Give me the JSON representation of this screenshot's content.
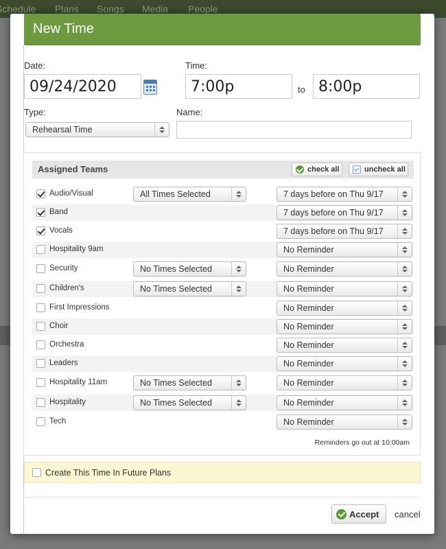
{
  "background_nav": [
    "Schedule",
    "Plans",
    "Songs",
    "Media",
    "People"
  ],
  "modal": {
    "title": "New Time",
    "date_label": "Date:",
    "date_value": "09/24/2020",
    "time_label": "Time:",
    "time_start": "7:00p",
    "time_to": "to",
    "time_end": "8:00p",
    "type_label": "Type:",
    "type_value": "Rehearsal Time",
    "name_label": "Name:",
    "name_value": ""
  },
  "teams": {
    "heading": "Assigned Teams",
    "check_all": "check all",
    "uncheck_all": "uncheck all",
    "rows": [
      {
        "name": "Audio/Visual",
        "checked": true,
        "times": "All Times Selected",
        "reminder": "7 days before on Thu 9/17"
      },
      {
        "name": "Band",
        "checked": true,
        "times": null,
        "reminder": "7 days before on Thu 9/17"
      },
      {
        "name": "Vocals",
        "checked": true,
        "times": null,
        "reminder": "7 days before on Thu 9/17"
      },
      {
        "name": "Hospitality 9am",
        "checked": false,
        "times": null,
        "reminder": "No Reminder"
      },
      {
        "name": "Security",
        "checked": false,
        "times": "No Times Selected",
        "reminder": "No Reminder"
      },
      {
        "name": "Children's",
        "checked": false,
        "times": "No Times Selected",
        "reminder": "No Reminder"
      },
      {
        "name": "First Impressions",
        "checked": false,
        "times": null,
        "reminder": "No Reminder"
      },
      {
        "name": "Choir",
        "checked": false,
        "times": null,
        "reminder": "No Reminder"
      },
      {
        "name": "Orchestra",
        "checked": false,
        "times": null,
        "reminder": "No Reminder"
      },
      {
        "name": "Leaders",
        "checked": false,
        "times": null,
        "reminder": "No Reminder"
      },
      {
        "name": "Hospitality 11am",
        "checked": false,
        "times": "No Times Selected",
        "reminder": "No Reminder"
      },
      {
        "name": "Hospitality",
        "checked": false,
        "times": "No Times Selected",
        "reminder": "No Reminder"
      },
      {
        "name": "Tech",
        "checked": false,
        "times": null,
        "reminder": "No Reminder"
      }
    ],
    "reminder_note": "Reminders go out at 10:00am"
  },
  "future_plans": {
    "label": "Create This Time In Future Plans",
    "checked": false
  },
  "footer": {
    "accept": "Accept",
    "cancel": "cancel"
  }
}
